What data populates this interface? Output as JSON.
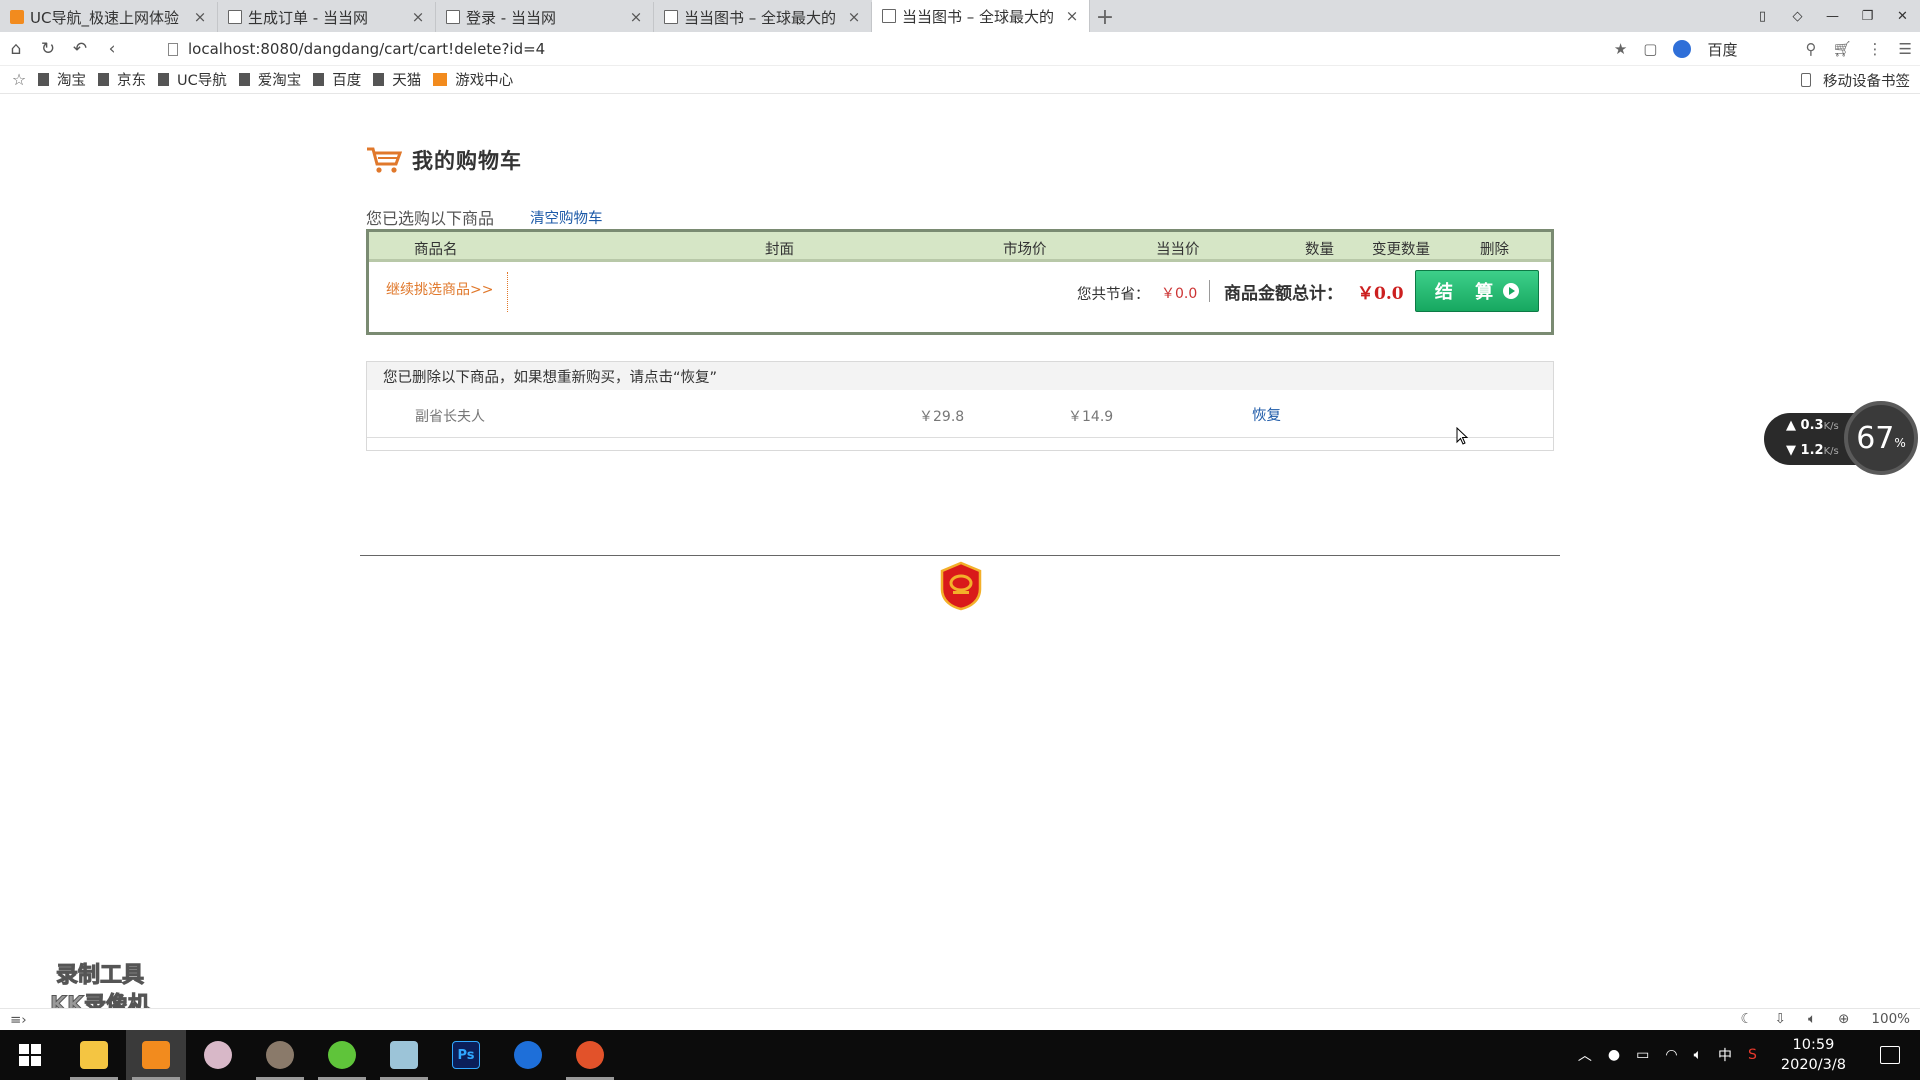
{
  "tabs": [
    {
      "title": "UC导航_极速上网体验",
      "icon": "uc-icon",
      "active": false
    },
    {
      "title": "生成订单 - 当当网",
      "icon": "page-icon",
      "active": false
    },
    {
      "title": "登录 - 当当网",
      "icon": "page-icon",
      "active": false
    },
    {
      "title": "当当图书 – 全球最大的",
      "icon": "page-icon",
      "active": false
    },
    {
      "title": "当当图书 – 全球最大的",
      "icon": "page-icon",
      "active": true
    }
  ],
  "addressbar": {
    "url": "localhost:8080/dangdang/cart/cart!delete?id=4",
    "search_engine": "百度"
  },
  "bookmarks": [
    "淘宝",
    "京东",
    "UC导航",
    "爱淘宝",
    "百度",
    "天猫",
    "游戏中心"
  ],
  "bookmarks_right": "移动设备书签",
  "cart": {
    "title": "我的购物车",
    "selected_label": "您已选购以下商品",
    "clear_link": "清空购物车",
    "columns": [
      "商品名",
      "封面",
      "市场价",
      "当当价",
      "数量",
      "变更数量",
      "删除"
    ],
    "continue_link": "继续挑选商品>>",
    "save_label": "您共节省：",
    "save_value": "￥0.0",
    "total_label": "商品金额总计：",
    "total_value": "￥0.0",
    "checkout_label": "结 算"
  },
  "deleted": {
    "header": "您已删除以下商品，如果想重新购买，请点击“恢复”",
    "rows": [
      {
        "name": "副省长夫人",
        "market_price": "￥29.8",
        "dang_price": "￥14.9",
        "action": "恢复"
      }
    ]
  },
  "speed_widget": {
    "up": "0.3",
    "down": "1.2",
    "unit": "K/s",
    "percent": "67"
  },
  "watermark": [
    "录制工具",
    "KK录像机"
  ],
  "statusbar": {
    "zoom": "100%"
  },
  "taskbar": {
    "time": "10:59",
    "date": "2020/3/8",
    "ime": "中"
  },
  "colors": {
    "accent_orange": "#e0782b",
    "link_blue": "#1d5aa8",
    "price_red": "#cc1f1f",
    "checkout_green": "#17a860",
    "header_green": "#d6e6c6"
  }
}
